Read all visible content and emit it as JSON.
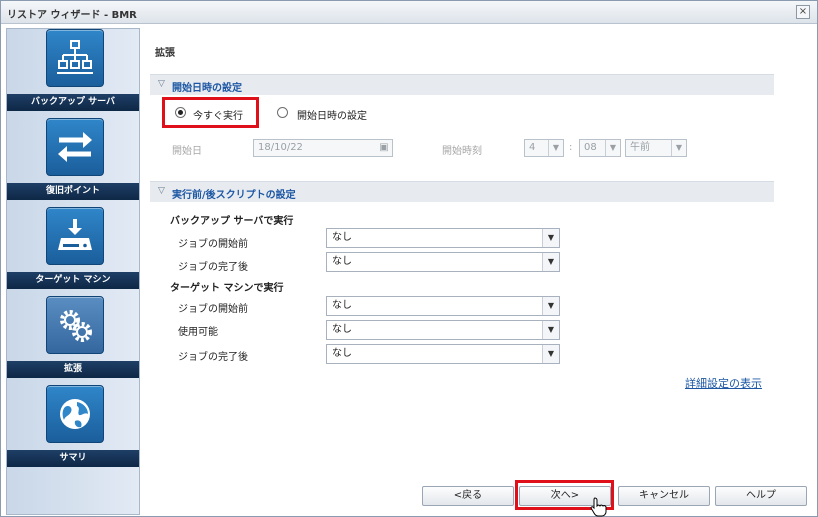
{
  "window": {
    "title": "リストア ウィザード - BMR",
    "close": "×"
  },
  "sidebar": {
    "items": [
      {
        "label": "バックアップ サーバ",
        "icon": "network-icon"
      },
      {
        "label": "復旧ポイント",
        "icon": "arrows-icon"
      },
      {
        "label": "ターゲット マシン",
        "icon": "drive-icon"
      },
      {
        "label": "拡張",
        "icon": "gear-icon"
      },
      {
        "label": "サマリ",
        "icon": "globe-icon"
      }
    ]
  },
  "main": {
    "title": "拡張",
    "start_section": {
      "header": "開始日時の設定",
      "run_now_label": "今すぐ実行",
      "set_datetime_label": "開始日時の設定",
      "start_date_label": "開始日",
      "start_date_value": "18/10/22",
      "start_time_label": "開始時刻",
      "hour": "4",
      "colon": ":",
      "minute": "08",
      "ampm": "午前"
    },
    "script_section": {
      "header": "実行前/後スクリプトの設定",
      "backup_server_heading": "バックアップ サーバで実行",
      "target_machine_heading": "ターゲット マシンで実行",
      "rows": {
        "bs_before_label": "ジョブの開始前",
        "bs_before_value": "なし",
        "bs_after_label": "ジョブの完了後",
        "bs_after_value": "なし",
        "tm_before_label": "ジョブの開始前",
        "tm_before_value": "なし",
        "tm_available_label": "使用可能",
        "tm_available_value": "なし",
        "tm_after_label": "ジョブの完了後",
        "tm_after_value": "なし"
      }
    },
    "advanced_link": "詳細設定の表示"
  },
  "footer": {
    "back": "<戻る",
    "next": "次へ>",
    "cancel": "キャンセル",
    "help": "ヘルプ"
  },
  "colors": {
    "accent": "#1d57a4",
    "highlight": "#e0101a",
    "sidebar_label_bg": "#0e2746"
  }
}
